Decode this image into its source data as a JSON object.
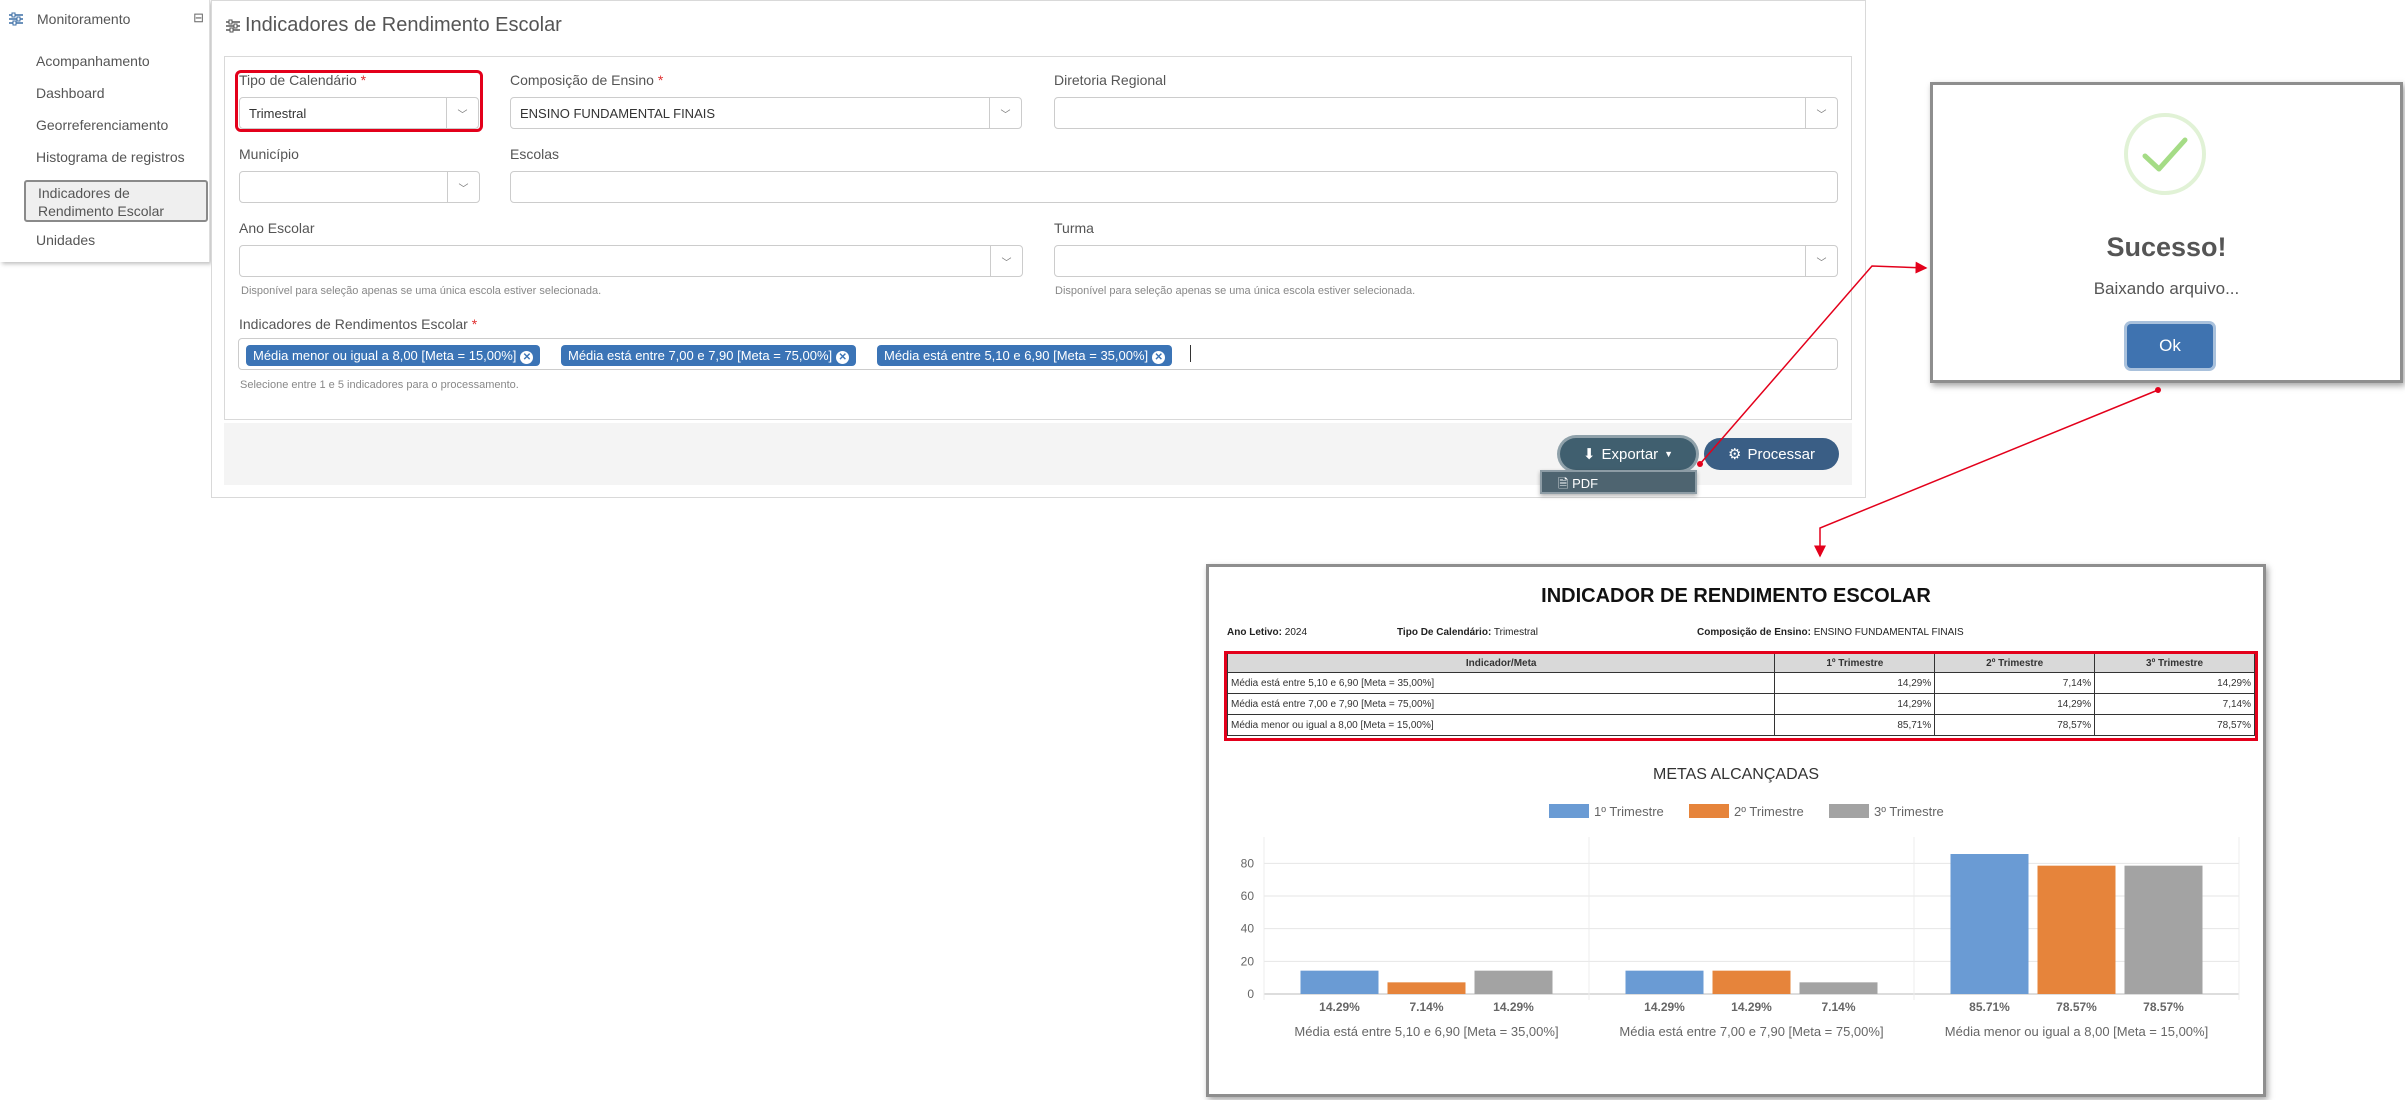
{
  "sidebar": {
    "section_title": "Monitoramento",
    "items": [
      {
        "label": "Acompanhamento"
      },
      {
        "label": "Dashboard"
      },
      {
        "label": "Georreferenciamento"
      },
      {
        "label": "Histograma de registros"
      },
      {
        "label": "Indicadores de Rendimento Escolar",
        "line1": "Indicadores de",
        "line2": "Rendimento Escolar"
      },
      {
        "label": "Unidades"
      }
    ]
  },
  "page": {
    "title": "Indicadores de Rendimento Escolar"
  },
  "form": {
    "tipo_calendario": {
      "label": "Tipo de Calendário",
      "required_mark": "*",
      "value": "Trimestral"
    },
    "composicao_ensino": {
      "label": "Composição de Ensino",
      "required_mark": "*",
      "value": "ENSINO FUNDAMENTAL FINAIS"
    },
    "diretoria_regional": {
      "label": "Diretoria Regional",
      "value": ""
    },
    "municipio": {
      "label": "Município",
      "value": ""
    },
    "escolas": {
      "label": "Escolas",
      "value": ""
    },
    "ano_escolar": {
      "label": "Ano Escolar",
      "value": "",
      "help": "Disponível para seleção apenas se uma única escola estiver selecionada."
    },
    "turma": {
      "label": "Turma",
      "value": "",
      "help": "Disponível para seleção apenas se uma única escola estiver selecionada."
    },
    "indicadores": {
      "label": "Indicadores de Rendimentos Escolar",
      "required_mark": "*",
      "tags": [
        "Média menor ou igual a 8,00 [Meta = 15,00%]",
        "Média está entre 7,00 e 7,90 [Meta = 75,00%]",
        "Média está entre 5,10 e 6,90 [Meta = 35,00%]"
      ],
      "help": "Selecione entre 1 e 5 indicadores para o processamento."
    }
  },
  "actions": {
    "export_label": "Exportar",
    "process_label": "Processar",
    "export_menu": [
      {
        "label": "PDF"
      }
    ]
  },
  "modal": {
    "title": "Sucesso!",
    "text": "Baixando arquivo...",
    "ok_label": "Ok",
    "accent": "#a5dc86"
  },
  "report": {
    "title": "INDICADOR DE RENDIMENTO ESCOLAR",
    "meta": {
      "ano_label": "Ano Letivo:",
      "ano_value": "2024",
      "tipo_label": "Tipo De Calendário:",
      "tipo_value": "Trimestral",
      "comp_label": "Composição de Ensino:",
      "comp_value": "ENSINO FUNDAMENTAL FINAIS"
    },
    "table": {
      "headers": [
        "Indicador/Meta",
        "1º Trimestre",
        "2º Trimestre",
        "3º Trimestre"
      ],
      "rows": [
        [
          "Média está entre 5,10 e 6,90 [Meta = 35,00%]",
          "14,29%",
          "7,14%",
          "14,29%"
        ],
        [
          "Média está entre 7,00 e 7,90 [Meta = 75,00%]",
          "14,29%",
          "14,29%",
          "7,14%"
        ],
        [
          "Média menor ou igual a 8,00 [Meta = 15,00%]",
          "85,71%",
          "78,57%",
          "78,57%"
        ]
      ]
    }
  },
  "chart_data": {
    "type": "bar",
    "title": "METAS ALCANÇADAS",
    "categories": [
      "Média está entre 5,10 e 6,90 [Meta = 35,00%]",
      "Média está entre 7,00 e 7,90 [Meta = 75,00%]",
      "Média menor ou igual a 8,00 [Meta = 15,00%]"
    ],
    "series": [
      {
        "name": "1º Trimestre",
        "color": "#6a9bd4",
        "values": [
          14.29,
          14.29,
          85.71
        ],
        "labels": [
          "14.29%",
          "14.29%",
          "85.71%"
        ]
      },
      {
        "name": "2º Trimestre",
        "color": "#e6843b",
        "values": [
          7.14,
          14.29,
          78.57
        ],
        "labels": [
          "7.14%",
          "14.29%",
          "78.57%"
        ]
      },
      {
        "name": "3º Trimestre",
        "color": "#a3a3a3",
        "values": [
          14.29,
          7.14,
          78.57
        ],
        "labels": [
          "14.29%",
          "7.14%",
          "78.57%"
        ]
      }
    ],
    "yticks": [
      0,
      20,
      40,
      60,
      80
    ],
    "ylim": [
      0,
      90
    ],
    "grid": true,
    "legend": "top-center"
  }
}
